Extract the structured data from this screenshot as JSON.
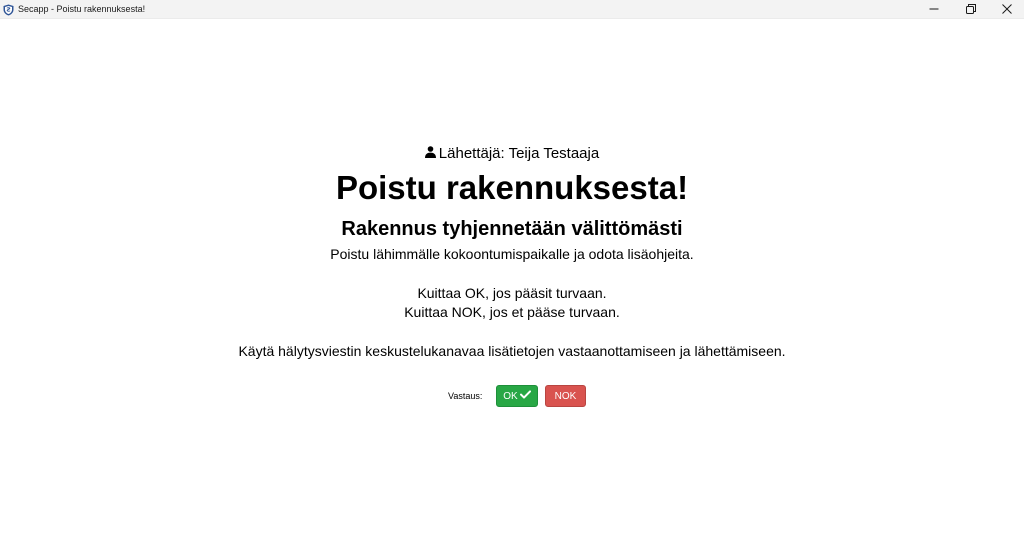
{
  "window": {
    "title": "Secapp - Poistu rakennuksesta!",
    "app_icon": "shield-icon",
    "controls": {
      "minimize_icon": "minimize-icon",
      "restore_icon": "restore-icon",
      "close_icon": "close-icon"
    }
  },
  "message": {
    "sender_icon": "user-icon",
    "sender": "Lähettäjä: Teija Testaaja",
    "title": "Poistu rakennuksesta!",
    "subtitle": "Rakennus tyhjennetään välittömästi",
    "body_line_1": "Poistu lähimmälle kokoontumispaikalle ja odota lisäohjeita.",
    "body_line_2": "Kuittaa OK, jos pääsit turvaan.",
    "body_line_3": "Kuittaa NOK, jos et pääse turvaan.",
    "body_line_4": "Käytä hälytysviestin keskustelukanavaa lisätietojen vastaanottamiseen ja lähettämiseen."
  },
  "response": {
    "label": "Vastaus:",
    "ok_label": "OK",
    "ok_icon": "checkmark-icon",
    "nok_label": "NOK"
  },
  "colors": {
    "ok_button": "#28a745",
    "nok_button": "#d9534f",
    "app_icon": "#2f5597"
  }
}
